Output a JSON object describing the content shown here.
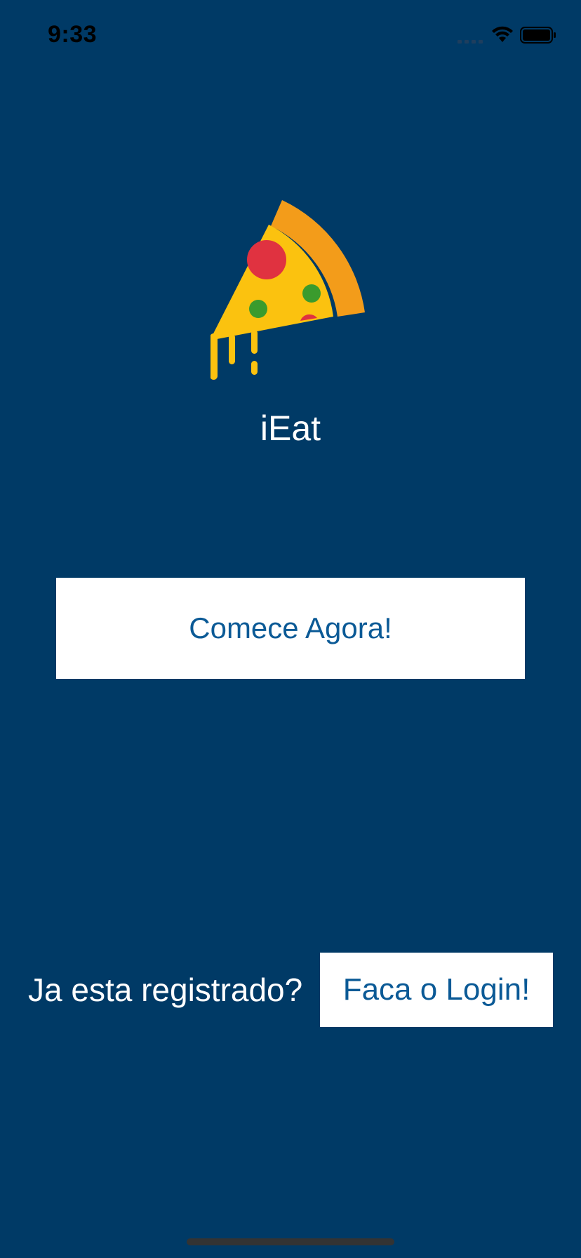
{
  "status_bar": {
    "time": "9:33",
    "icons": [
      "signal-icon",
      "wifi-icon",
      "battery-icon"
    ]
  },
  "logo": {
    "icon": "pizza-slice-icon",
    "colors": {
      "crust": "#f39c1a",
      "cheese": "#fbc20f",
      "pepperoni": "#e03240",
      "olive": "#3a9b2d"
    }
  },
  "app": {
    "title": "iEat"
  },
  "start_button": {
    "label": "Comece Agora!"
  },
  "login": {
    "prompt": "Ja esta registrado?",
    "button_label": "Faca o Login!"
  },
  "colors": {
    "background": "#003a66",
    "button_background": "#ffffff",
    "button_text": "#0b5a96",
    "text_light": "#ffffff"
  }
}
